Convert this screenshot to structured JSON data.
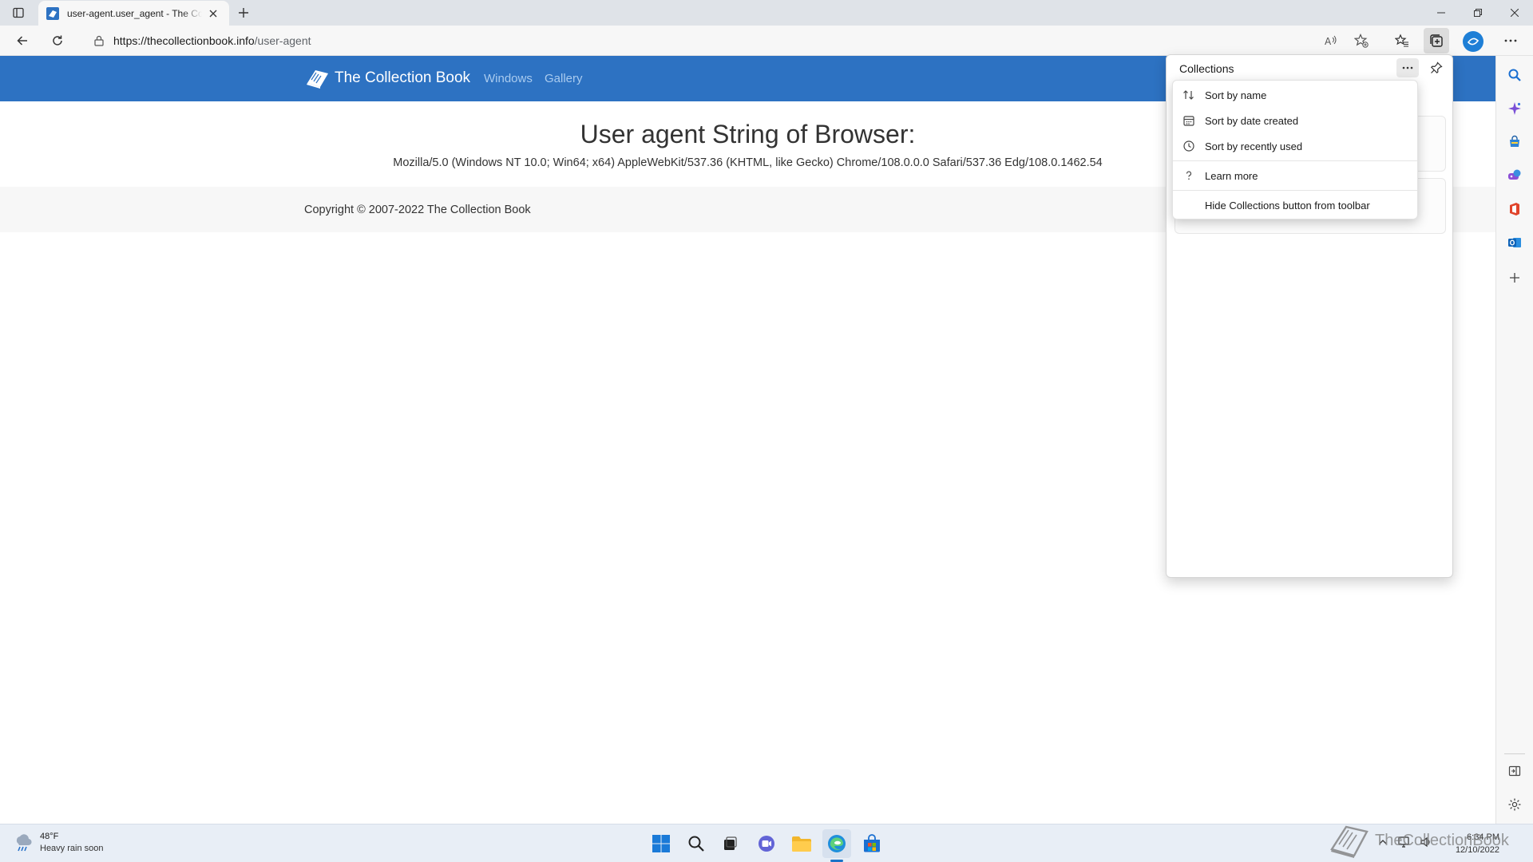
{
  "browser": {
    "tab": {
      "title": "user-agent.user_agent - The Collection Book"
    },
    "address": {
      "host": "https://thecollectionbook.info",
      "path": "/user-agent"
    },
    "toolbar_icons": [
      "back-icon",
      "refresh-icon",
      "lock-icon",
      "read-aloud-icon",
      "add-favorite-icon",
      "favorites-icon",
      "collections-icon",
      "profile-icon",
      "more-icon"
    ]
  },
  "site": {
    "brand": "The Collection Book",
    "nav": [
      "Windows",
      "Gallery"
    ],
    "heading": "User agent String of Browser:",
    "user_agent": "Mozilla/5.0 (Windows NT 10.0; Win64; x64) AppleWebKit/537.36 (KHTML, like Gecko) Chrome/108.0.0.0 Safari/537.36 Edg/108.0.1462.54",
    "copyright": "Copyright © 2007-2022 The Collection Book",
    "colors": {
      "nav_bg": "#2d72c2",
      "nav_link": "#a9cbef",
      "footer_bg": "#f7f7f7"
    }
  },
  "collections": {
    "title": "Collections",
    "menu": [
      {
        "label": "Sort by name",
        "icon": "sort-icon"
      },
      {
        "label": "Sort by date created",
        "icon": "calendar-icon"
      },
      {
        "label": "Sort by recently used",
        "icon": "clock-icon"
      },
      {
        "label": "Learn more",
        "icon": "help-icon"
      },
      {
        "label": "Hide Collections button from toolbar",
        "icon": ""
      }
    ]
  },
  "sidebar_icons": [
    "search-icon",
    "copilot-icon",
    "shopping-icon",
    "games-icon",
    "office-icon",
    "outlook-icon",
    "add-icon",
    "split-screen-icon",
    "settings-icon"
  ],
  "taskbar": {
    "weather": {
      "temp": "48°F",
      "desc": "Heavy rain soon"
    },
    "watermark": "TheCollectionBook",
    "clock": {
      "time": "6:34 PM",
      "date": "12/10/2022"
    }
  }
}
